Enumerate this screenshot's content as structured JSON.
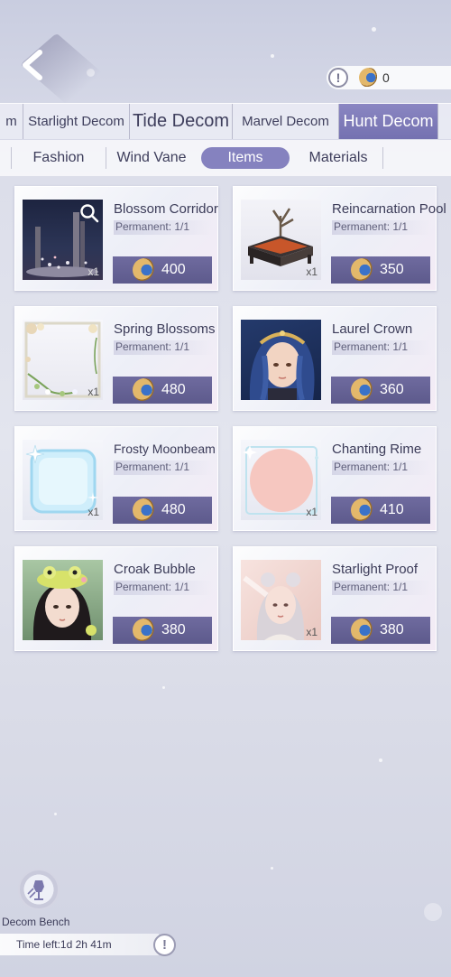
{
  "header": {
    "currency_info_icon": "info-icon",
    "currency_icon": "moon-coin-icon",
    "currency_amount": "0"
  },
  "category_tabs": [
    {
      "label": "m"
    },
    {
      "label": "Starlight Decom"
    },
    {
      "label": "Tide Decom"
    },
    {
      "label": "Marvel Decom"
    },
    {
      "label": "Hunt Decom",
      "active": true
    }
  ],
  "sub_tabs": [
    {
      "label": "Fashion"
    },
    {
      "label": "Wind Vane"
    },
    {
      "label": "Items",
      "active": true
    },
    {
      "label": "Materials"
    }
  ],
  "items": [
    {
      "name": "Blossom Corridor",
      "perm": "Permanent: 1/1",
      "price": "400",
      "qty": "x1"
    },
    {
      "name": "Reincarnation Pool",
      "perm": "Permanent: 1/1",
      "price": "350",
      "qty": "x1"
    },
    {
      "name": "Spring Blossoms",
      "perm": "Permanent: 1/1",
      "price": "480",
      "qty": "x1"
    },
    {
      "name": "Laurel Crown",
      "perm": "Permanent: 1/1",
      "price": "360",
      "qty": ""
    },
    {
      "name": "Frosty Moonbeam",
      "perm": "Permanent: 1/1",
      "price": "480",
      "qty": "x1"
    },
    {
      "name": "Chanting Rime",
      "perm": "Permanent: 1/1",
      "price": "410",
      "qty": "x1"
    },
    {
      "name": "Croak Bubble",
      "perm": "Permanent: 1/1",
      "price": "380",
      "qty": ""
    },
    {
      "name": "Starlight Proof",
      "perm": "Permanent: 1/1",
      "price": "380",
      "qty": "x1"
    }
  ],
  "bottom": {
    "bench_label": "Decom Bench",
    "time_left": "Time left:1d 2h 41m",
    "info_icon": "info-icon"
  },
  "colors": {
    "accent": "#7d7ab8",
    "price_button": "#645f94",
    "background": "#dcdeea"
  }
}
